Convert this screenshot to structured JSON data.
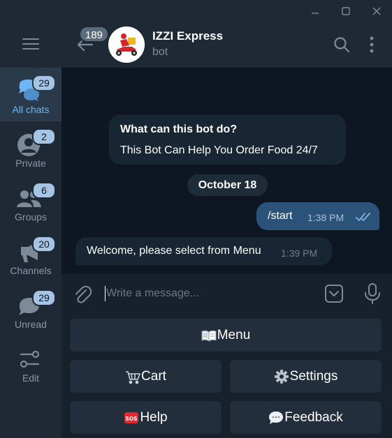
{
  "window": {
    "controls": [
      "minimize-icon",
      "maximize-icon",
      "close-icon"
    ]
  },
  "sidebar": {
    "menu_icon": "hamburger-icon",
    "folders": [
      {
        "label": "All chats",
        "badge": "29",
        "icon": "chat-bubbles-icon",
        "active": true
      },
      {
        "label": "Private",
        "badge": "2",
        "icon": "person-icon",
        "active": false
      },
      {
        "label": "Groups",
        "badge": "6",
        "icon": "people-icon",
        "active": false
      },
      {
        "label": "Channels",
        "badge": "20",
        "icon": "megaphone-icon",
        "active": false
      },
      {
        "label": "Unread",
        "badge": "29",
        "icon": "chat-bubble-icon",
        "active": false
      },
      {
        "label": "Edit",
        "badge": "",
        "icon": "sliders-icon",
        "active": false
      }
    ]
  },
  "header": {
    "back_badge": "189",
    "title": "IZZI Express",
    "subtitle": "bot"
  },
  "messages": {
    "info_title": "What can this bot do?",
    "info_text": "This Bot Can Help You Order Food 24/7",
    "date": "October 18",
    "outgoing": {
      "text": "/start",
      "time": "1:38 PM",
      "status": "read"
    },
    "incoming": {
      "text": "Welcome, please select from Menu",
      "time": "1:39 PM"
    }
  },
  "composer": {
    "placeholder": "Write a message..."
  },
  "keyboard": {
    "menu": "Menu",
    "cart": "Cart",
    "settings": "Settings",
    "help": "Help",
    "feedback": "Feedback"
  },
  "colors": {
    "accent": "#6fb6f2",
    "outgoing_bubble": "#2b5278",
    "incoming_bubble": "#182533",
    "badge": "#a6c4e4"
  }
}
